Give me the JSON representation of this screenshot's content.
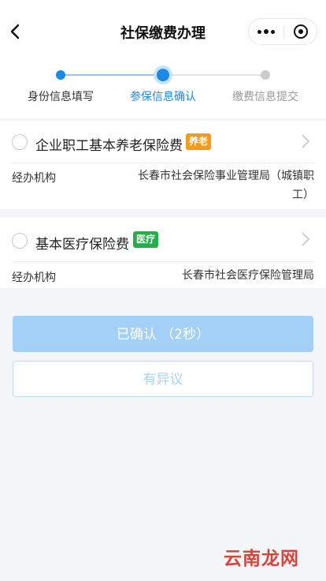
{
  "header": {
    "title": "社保缴费办理",
    "back_icon": "chevron-left-icon",
    "more_icon": "more-dots-icon",
    "close_icon": "target-circle-icon"
  },
  "steps": [
    {
      "label": "身份信息填写",
      "state": "done"
    },
    {
      "label": "参保信息确认",
      "state": "active"
    },
    {
      "label": "缴费信息提交",
      "state": "pending"
    }
  ],
  "colors": {
    "accent": "#1e88e5",
    "step_done_line": "#8ec5f5",
    "step_pending": "#cccccc",
    "tag_pension": "#f59a1a",
    "tag_medical": "#21b04b",
    "confirm_btn": "#a3d0f7",
    "watermark": "#d8443a"
  },
  "insurance_items": [
    {
      "title": "企业职工基本养老保险费",
      "tag": "养老",
      "field_label": "经办机构",
      "field_value_line1": "长春市社会保险事业管理局（城镇职",
      "field_value_line2": "工）"
    },
    {
      "title": "基本医疗保险费",
      "tag": "医疗",
      "field_label": "经办机构",
      "field_value_line1": "长春市社会医疗保险管理局"
    }
  ],
  "buttons": {
    "confirm_label": "已确认 （2秒）",
    "dispute_label": "有异议"
  },
  "watermark": "云南龙网"
}
